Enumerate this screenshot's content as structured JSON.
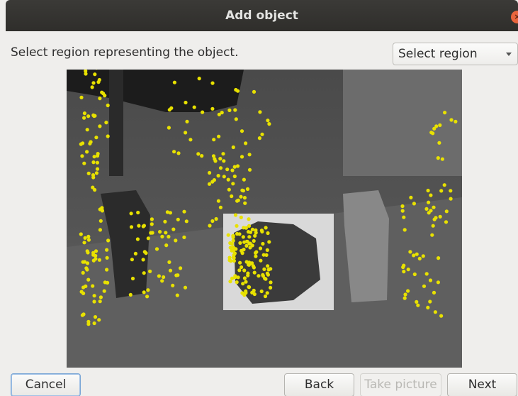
{
  "window": {
    "title": "Add object",
    "close_symbol": "×"
  },
  "instruction": "Select region representing the object.",
  "region_select": {
    "selected": "Select region"
  },
  "buttons": {
    "cancel": "Cancel",
    "back": "Back",
    "take_picture": "Take picture",
    "next": "Next"
  },
  "colors": {
    "keypoint": "#e8e100",
    "selection_box": "#ffffff"
  }
}
